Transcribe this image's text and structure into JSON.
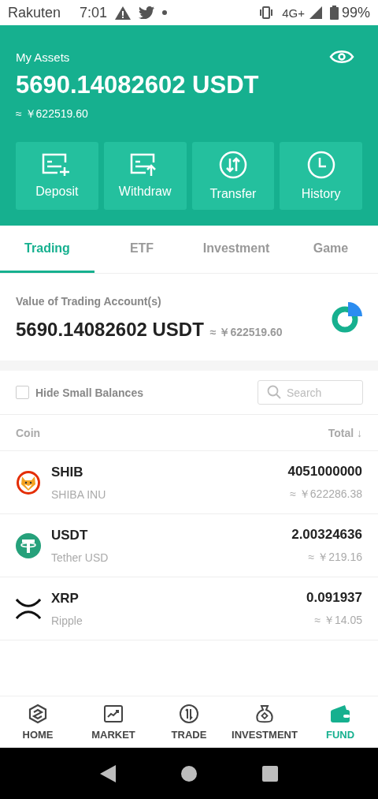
{
  "status_bar": {
    "carrier": "Rakuten",
    "time": "7:01",
    "network": "4G+",
    "battery": "99%"
  },
  "assets": {
    "label": "My Assets",
    "amount": "5690.14082602 USDT",
    "fiat": "≈ ￥622519.60"
  },
  "actions": [
    {
      "kind": "deposit",
      "label": "Deposit"
    },
    {
      "kind": "withdraw",
      "label": "Withdraw"
    },
    {
      "kind": "transfer",
      "label": "Transfer"
    },
    {
      "kind": "history",
      "label": "History"
    }
  ],
  "tabs": [
    {
      "label": "Trading",
      "selected": true
    },
    {
      "label": "ETF",
      "selected": false
    },
    {
      "label": "Investment",
      "selected": false
    },
    {
      "label": "Game",
      "selected": false
    }
  ],
  "account": {
    "label": "Value of Trading Account(s)",
    "amount": "5690.14082602 USDT",
    "fiat": "≈ ￥622519.60"
  },
  "filter": {
    "hide_small": {
      "label": "Hide Small Balances",
      "checked": false
    },
    "search": {
      "placeholder": "Search"
    }
  },
  "columns": [
    "Coin",
    "Total ↓"
  ],
  "coins": [
    {
      "kind": "shib",
      "symbol": "SHIB",
      "name": "SHIBA INU",
      "total": "4051000000",
      "fiat": "≈ ￥622286.38"
    },
    {
      "kind": "tether",
      "symbol": "USDT",
      "name": "Tether USD",
      "total": "2.00324636",
      "fiat": "≈ ￥219.16"
    },
    {
      "kind": "xrp",
      "symbol": "XRP",
      "name": "Ripple",
      "total": "0.091937",
      "fiat": "≈ ￥14.05"
    }
  ],
  "nav": [
    {
      "kind": "home",
      "label": "HOME",
      "selected": false
    },
    {
      "kind": "market",
      "label": "MARKET",
      "selected": false
    },
    {
      "kind": "trade",
      "label": "TRADE",
      "selected": false
    },
    {
      "kind": "investment",
      "label": "INVESTMENT",
      "selected": false
    },
    {
      "kind": "fund",
      "label": "FUND",
      "selected": true
    }
  ]
}
